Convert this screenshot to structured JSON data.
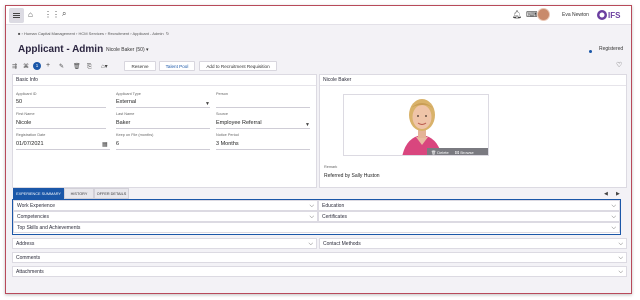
{
  "topbar": {
    "user_name": "Eva Newton",
    "logo_text": "IFS"
  },
  "breadcrumb": "Human Capital Management › HCM Services › Recruitment › Applicant - Admin",
  "page": {
    "title": "Applicant - Admin",
    "record_selector": "Nicole Baker (50)",
    "status": "Registered"
  },
  "toolbar": {
    "badge_count": "1",
    "reserve": "Reserve",
    "talent_pool": "Talent Pool",
    "add_to_requisition": "Add to Recruitment Requisition"
  },
  "basic_info": {
    "header": "Basic Info",
    "fields": {
      "applicant_id": {
        "label": "Applicant ID",
        "value": "50"
      },
      "applicant_type": {
        "label": "Applicant Type",
        "value": "External"
      },
      "person": {
        "label": "Person",
        "value": ""
      },
      "first_name": {
        "label": "First Name",
        "value": "Nicole"
      },
      "last_name": {
        "label": "Last Name",
        "value": "Baker"
      },
      "source": {
        "label": "Source",
        "value": "Employee Referral"
      },
      "registration_date": {
        "label": "Registration Date",
        "value": "01/07/2021"
      },
      "keep_on_file": {
        "label": "Keep on File (months)",
        "value": "6"
      },
      "notice_period": {
        "label": "Notice Period",
        "value": "3 Months"
      }
    }
  },
  "person_panel": {
    "header": "Nicole Baker",
    "delete": "Delete",
    "browse": "Browse",
    "remark_label": "Remark",
    "remark_value": "Referred by Sally Huston"
  },
  "tabs": [
    "EXPERIENCE SUMMARY",
    "HISTORY",
    "OFFER DETAILS"
  ],
  "sections_left": [
    "Work Experience",
    "Competencies",
    "Top Skills and Achievements"
  ],
  "sections_right": [
    "Education",
    "Certificates"
  ],
  "sections_bottom": [
    "Address",
    "Comments",
    "Attachments"
  ],
  "sections_bottom_right": [
    "Contact Methods"
  ],
  "colors": {
    "accent": "#1b57a8",
    "frame": "#b84a5a",
    "background": "#f3f2f6"
  }
}
